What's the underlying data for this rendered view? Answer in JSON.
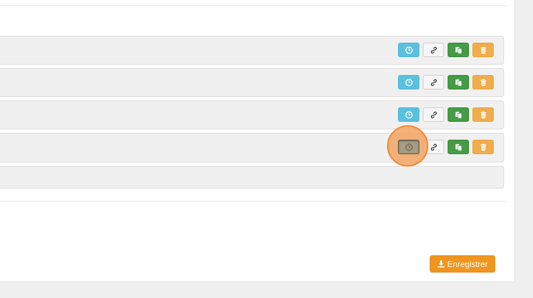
{
  "rows": [
    {
      "actions": [
        "clock-icon",
        "link-icon",
        "copy-icon",
        "trash-icon"
      ]
    },
    {
      "actions": [
        "clock-icon",
        "link-icon",
        "copy-icon",
        "trash-icon"
      ]
    },
    {
      "actions": [
        "clock-icon",
        "link-icon",
        "copy-icon",
        "trash-icon"
      ]
    },
    {
      "actions": [
        "clock-icon",
        "link-icon",
        "copy-icon",
        "trash-icon"
      ],
      "history_active": true
    },
    {
      "actions": []
    }
  ],
  "colors": {
    "history": "#5bc0de",
    "link": "#f6f6f6",
    "copy": "#449d44",
    "delete": "#f0ad4e",
    "save": "#f0961e",
    "click_highlight": "#f39648"
  },
  "footer": {
    "save_label": "Enregistrer",
    "save_icon": "download-icon"
  }
}
